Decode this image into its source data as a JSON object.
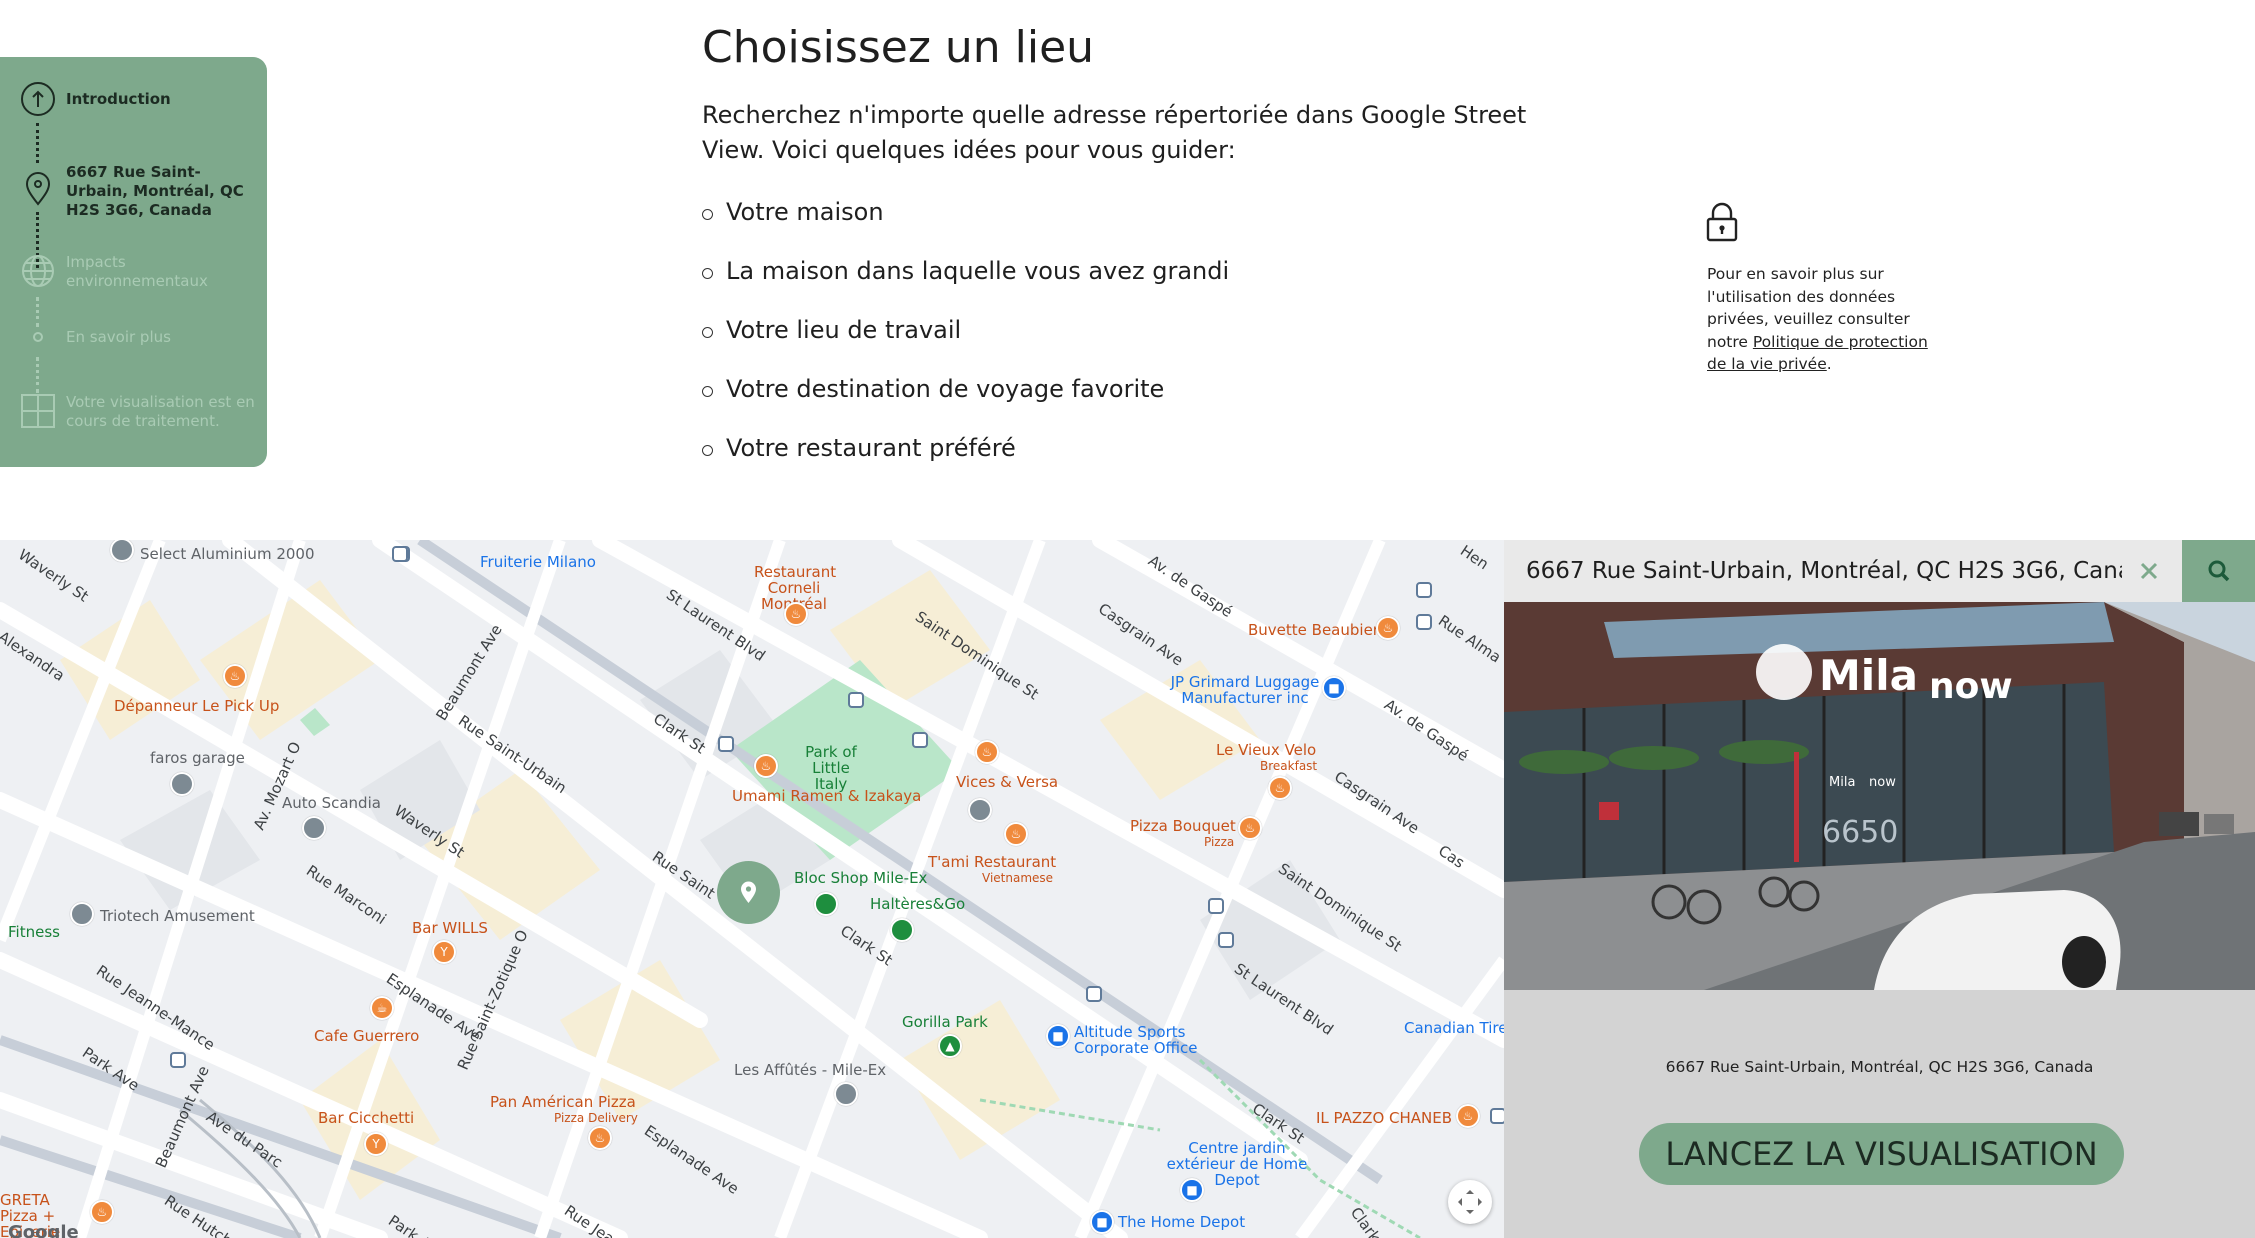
{
  "steps": [
    {
      "label": "Introduction",
      "icon": "arrow-up-circle-icon",
      "state": "active"
    },
    {
      "label": "6667 Rue Saint-Urbain, Montréal, QC H2S 3G6, Canada",
      "icon": "location-pin-icon",
      "state": "active"
    },
    {
      "label": "Impacts environnementaux",
      "icon": "globe-icon",
      "state": "inactive"
    },
    {
      "label": "En savoir plus",
      "icon": "dot-icon",
      "state": "inactive"
    },
    {
      "label": "Votre visualisation est en cours de traitement.",
      "icon": "grid-icon",
      "state": "inactive"
    }
  ],
  "intro": {
    "title": "Choisissez un lieu",
    "lead": "Recherchez n'importe quelle adresse répertoriée dans Google Street View. Voici quelques idées pour vous guider:",
    "ideas": [
      "Votre maison",
      "La maison dans laquelle vous avez grandi",
      "Votre lieu de travail",
      "Votre destination de voyage favorite",
      "Votre restaurant préféré"
    ]
  },
  "privacy": {
    "text": "Pour en savoir plus sur l'utilisation des données privées, veuillez consulter notre",
    "link": "Politique de protection de la vie privée",
    "end": "."
  },
  "map": {
    "places": [
      {
        "name": "Select Aluminium 2000",
        "color": "g"
      },
      {
        "name": "Fruiterie Milano",
        "color": "b"
      },
      {
        "name": "Restaurant Corneli Montréal",
        "color": "o"
      },
      {
        "name": "Buvette Beaubien",
        "color": "o"
      },
      {
        "name": "JP Grimard Luggage Manufacturer inc",
        "color": "b"
      },
      {
        "name": "Dépanneur Le Pick Up",
        "color": "o"
      },
      {
        "name": "faros garage",
        "color": "g"
      },
      {
        "name": "Auto Scandia",
        "color": "g"
      },
      {
        "name": "Park of Little Italy",
        "color": "gr"
      },
      {
        "name": "Umami Ramen & Izakaya",
        "color": "o"
      },
      {
        "name": "Vices & Versa",
        "color": "o"
      },
      {
        "name": "Le Vieux Velo",
        "color": "o"
      },
      {
        "name": "Breakfast",
        "color": "o"
      },
      {
        "name": "Pizza Bouquet",
        "color": "o"
      },
      {
        "name": "Pizza",
        "color": "o"
      },
      {
        "name": "T'ami Restaurant",
        "color": "o"
      },
      {
        "name": "Vietnamese",
        "color": "o"
      },
      {
        "name": "Bloc Shop Mile-Ex",
        "color": "gr"
      },
      {
        "name": "Haltères&Go",
        "color": "gr"
      },
      {
        "name": "Triotech Amusement",
        "color": "g"
      },
      {
        "name": "Fitness",
        "color": "gr"
      },
      {
        "name": "Bar WILLS",
        "color": "o"
      },
      {
        "name": "Cafe Guerrero",
        "color": "o"
      },
      {
        "name": "Gorilla Park",
        "color": "gr"
      },
      {
        "name": "Altitude Sports Corporate Office",
        "color": "b"
      },
      {
        "name": "Canadian Tire",
        "color": "b"
      },
      {
        "name": "Les Affûtés - Mile-Ex",
        "color": "g"
      },
      {
        "name": "Bar Cicchetti",
        "color": "o"
      },
      {
        "name": "Pan Américan Pizza",
        "color": "o"
      },
      {
        "name": "Pizza Delivery",
        "color": "o"
      },
      {
        "name": "IL PAZZO CHANEB",
        "color": "o"
      },
      {
        "name": "Centre jardin extérieur de Home Depot",
        "color": "b"
      },
      {
        "name": "The Home Depot",
        "color": "b"
      },
      {
        "name": "GRETA Pizza + Epicerie",
        "color": "o"
      }
    ],
    "streets": [
      "Waverly St",
      "Alexandra",
      "St Laurent Blvd",
      "Saint Dominique St",
      "Av. de Gaspé",
      "Casgrain Ave",
      "Rue Alma",
      "Beaumont Ave",
      "Rue Saint-Urbain",
      "Clark St",
      "Av. Mozart O",
      "Rue Marconi",
      "Esplanade Ave",
      "Rue Saint-Zotique O",
      "Rue Jeanne-Mance",
      "Park Ave",
      "Ave du Parc",
      "Rue Hutchison",
      "Rue Saint",
      "Cas",
      "Canadian Tire",
      "Hen",
      "Clark S"
    ],
    "logo": "Google"
  },
  "search": {
    "value": "6667 Rue Saint-Urbain, Montréal, QC H2S 3G6, Canada",
    "clear_icon": "close-icon",
    "search_icon": "search-icon"
  },
  "preview": {
    "sign": "Mila",
    "sign2": "now",
    "door_small": "Mila",
    "door_small2": "now",
    "number": "6650",
    "address": "6667 Rue Saint-Urbain, Montréal, QC H2S 3G6, Canada"
  },
  "cta": {
    "label": "LANCEZ LA VISUALISATION"
  },
  "colors": {
    "accent": "#7ea98c",
    "panel": "#d3d3d3"
  }
}
